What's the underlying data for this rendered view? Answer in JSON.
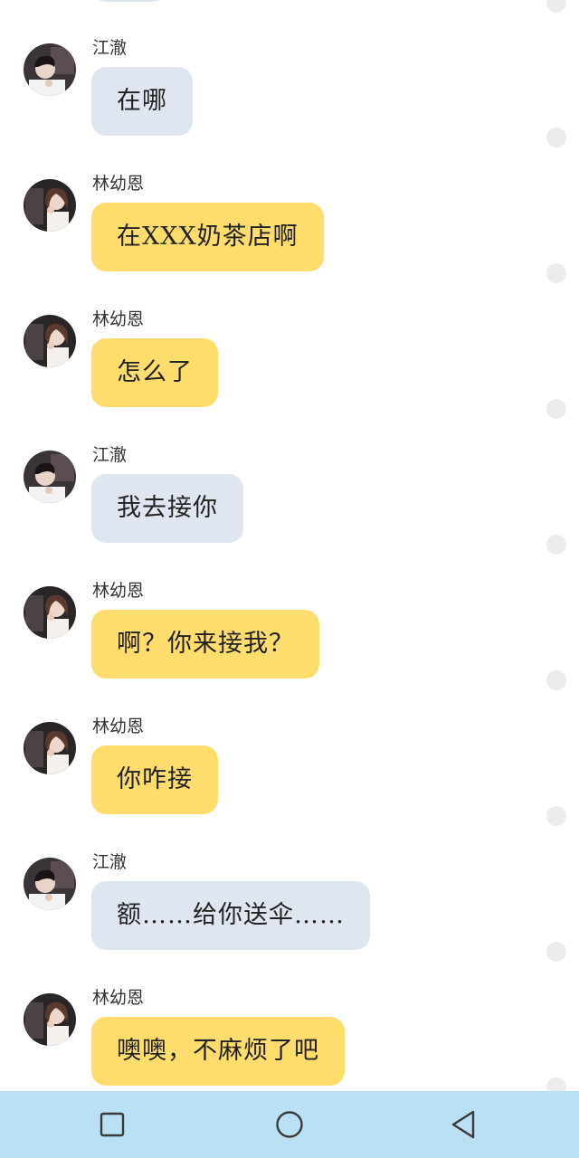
{
  "messages": [
    {
      "sender": "江澈",
      "text": "在哪",
      "avatar": "jiangche-avatar",
      "color": "#e0e6ef"
    },
    {
      "sender": "林幼恩",
      "text": "在XXX奶茶店啊",
      "avatar": "linyouen-avatar",
      "color": "#ffdd6d"
    },
    {
      "sender": "林幼恩",
      "text": "怎么了",
      "avatar": "linyouen-avatar",
      "color": "#ffdd6d"
    },
    {
      "sender": "江澈",
      "text": "我去接你",
      "avatar": "jiangche-avatar",
      "color": "#e0e6ef"
    },
    {
      "sender": "林幼恩",
      "text": "啊？你来接我？",
      "avatar": "linyouen-avatar",
      "color": "#ffdd6d"
    },
    {
      "sender": "林幼恩",
      "text": "你咋接",
      "avatar": "linyouen-avatar",
      "color": "#ffdd6d"
    },
    {
      "sender": "江澈",
      "text": "额……给你送伞……",
      "avatar": "jiangche-avatar",
      "color": "#e0e6ef"
    },
    {
      "sender": "林幼恩",
      "text": "噢噢，不麻烦了吧",
      "avatar": "linyouen-avatar",
      "color": "#ffdd6d"
    }
  ],
  "navbar": {
    "background": "#b9e0f3",
    "recent_icon": "square-icon",
    "home_icon": "circle-icon",
    "back_icon": "triangle-back-icon"
  }
}
